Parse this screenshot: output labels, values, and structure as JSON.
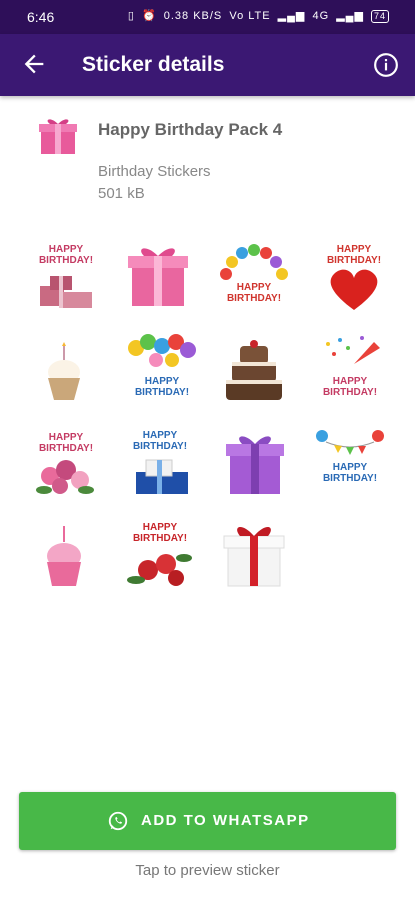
{
  "status": {
    "time": "6:46",
    "net_speed": "0.38 KB/S",
    "network_a": "Vo LTE",
    "network_b": "4G",
    "battery": "74"
  },
  "toolbar": {
    "title": "Sticker details"
  },
  "pack": {
    "name": "Happy Birthday Pack 4",
    "publisher": "Birthday Stickers",
    "size": "501 kB"
  },
  "stickers": {
    "s1": "HAPPY BIRTHDAY!",
    "s3": "HAPPY BIRTHDAY!",
    "s4": "HAPPY BIRTHDAY!",
    "s6": "HAPPY BIRTHDAY!",
    "s8": "HAPPY BIRTHDAY!",
    "s9": "HAPPY BIRTHDAY!",
    "s10": "HAPPY BIRTHDAY!",
    "s12": "HAPPY BIRTHDAY!",
    "s14": "HAPPY BIRTHDAY!"
  },
  "actions": {
    "add_label": "ADD TO WHATSAPP",
    "hint": "Tap to preview sticker"
  }
}
